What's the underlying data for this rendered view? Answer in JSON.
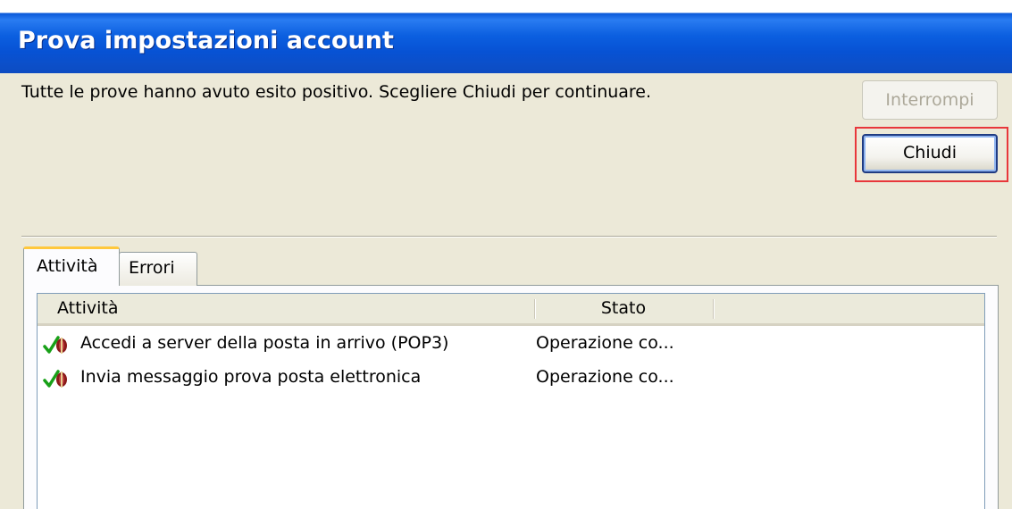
{
  "window": {
    "title": "Prova impostazioni account"
  },
  "message": "Tutte le prove hanno avuto esito positivo. Scegliere Chiudi per continuare.",
  "buttons": {
    "interrompi": "Interrompi",
    "chiudi": "Chiudi"
  },
  "tabs": [
    {
      "label": "Attività",
      "selected": true
    },
    {
      "label": "Errori",
      "selected": false
    }
  ],
  "list": {
    "columns": [
      "Attività",
      "Stato"
    ],
    "rows": [
      {
        "icon": "success-check-icon",
        "task": "Accedi a server della posta in arrivo (POP3)",
        "status": "Operazione co..."
      },
      {
        "icon": "success-check-icon",
        "task": "Invia messaggio prova posta elettronica",
        "status": "Operazione co..."
      }
    ]
  },
  "colors": {
    "titlebar": "#0a58d8",
    "highlight": "#e8373b",
    "success": "#18a018",
    "active_tab_accent": "#ffc83c"
  }
}
